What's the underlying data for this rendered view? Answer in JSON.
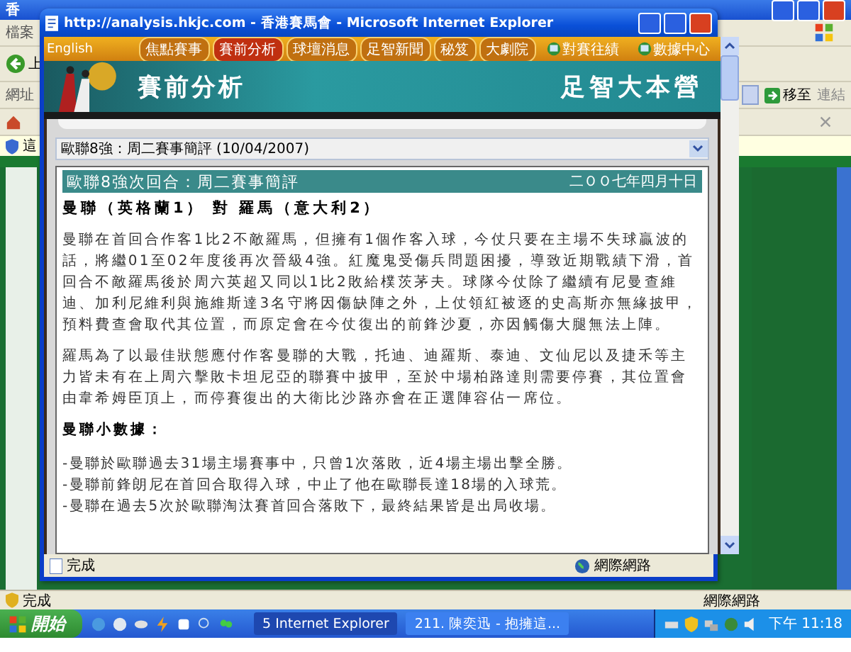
{
  "background_window": {
    "title": "香",
    "menu": "檔案",
    "back_label": "上",
    "address_label": "網址",
    "go": "移至",
    "links": "連結",
    "info_bar": "這",
    "status": "完成",
    "zone": "網際網路"
  },
  "popup": {
    "title": "http://analysis.hkjc.com - 香港賽馬會 - Microsoft Internet Explorer",
    "language_link": "English",
    "nav": [
      {
        "label": "焦點賽事",
        "kind": "tab",
        "selected": false
      },
      {
        "label": "賽前分析",
        "kind": "tab",
        "selected": true
      },
      {
        "label": "球壇消息",
        "kind": "tab",
        "selected": false
      },
      {
        "label": "足智新聞",
        "kind": "tab",
        "selected": false
      },
      {
        "label": "秘笈",
        "kind": "tab",
        "selected": false
      },
      {
        "label": "大劇院",
        "kind": "tab",
        "selected": false
      },
      {
        "label": "對賽往績",
        "kind": "icon_link",
        "selected": false
      },
      {
        "label": "數據中心",
        "kind": "icon_link",
        "selected": false
      }
    ],
    "banner_title": "賽前分析",
    "banner_brand": "足智大本營",
    "article_select": "歐聯8強：周二賽事簡評 (10/04/2007)",
    "article": {
      "title": "歐聯8強次回合：周二賽事簡評",
      "date": "二ＯＯ七年四月十日",
      "match": "曼聯（英格蘭1） 對 羅馬（意大利2）",
      "paragraphs": [
        "曼聯在首回合作客1比2不敵羅馬，但擁有1個作客入球，今仗只要在主場不失球贏波的話，將繼01至02年度後再次晉級4強。紅魔鬼受傷兵問題困擾，導致近期戰績下滑，首回合不敵羅馬後於周六英超又同以1比2敗給樸茨茅夫。球隊今仗除了繼續有尼曼查維迪、加利尼維利與施維斯達3名守將因傷缺陣之外，上仗領紅被逐的史高斯亦無緣披甲，預料費查會取代其位置，而原定會在今仗復出的前鋒沙夏，亦因觸傷大腿無法上陣。",
        "羅馬為了以最佳狀態應付作客曼聯的大戰，托迪、迪羅斯、泰迪、文仙尼以及捷禾等主力皆未有在上周六擊敗卡坦尼亞的聯賽中披甲，至於中場柏路達則需要停賽，其位置會由韋希姆臣頂上，而停賽復出的大衛比沙路亦會在正選陣容佔一席位。"
      ],
      "facts_heading": "曼聯小數據：",
      "facts": [
        "-曼聯於歐聯過去31場主場賽事中，只曾1次落敗，近4場主場出擊全勝。",
        "-曼聯前鋒朗尼在首回合取得入球，中止了他在歐聯長達18場的入球荒。",
        "-曼聯在過去5次於歐聯淘汰賽首回合落敗下，最終結果皆是出局收場。"
      ]
    },
    "status": "完成",
    "zone": "網際網路"
  },
  "taskbar": {
    "start": "開始",
    "tasks": [
      {
        "label": "5 Internet Explorer",
        "selected": true
      },
      {
        "label": "211. 陳奕迅 - 抱擁這...",
        "selected": false
      }
    ],
    "clock": "下午 11:18"
  }
}
